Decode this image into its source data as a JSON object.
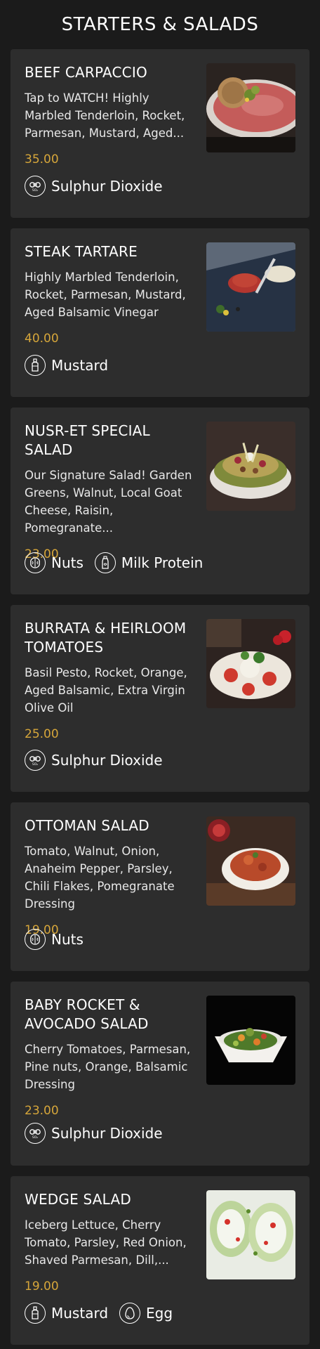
{
  "section": {
    "title": "STARTERS & SALADS"
  },
  "accent_color": "#d6a63a",
  "items": [
    {
      "title": "BEEF CARPACCIO",
      "description": "Tap to WATCH! Highly Marbled Tenderloin, Rocket, Parmesan, Mustard, Aged...",
      "price": "35.00",
      "allergens": [
        {
          "label": "Sulphur Dioxide",
          "icon": "sulphur-dioxide-icon"
        }
      ]
    },
    {
      "title": "STEAK TARTARE",
      "description": "Highly Marbled Tenderloin, Rocket, Parmesan, Mustard, Aged Balsamic Vinegar",
      "price": "40.00",
      "allergens": [
        {
          "label": "Mustard",
          "icon": "mustard-icon"
        }
      ]
    },
    {
      "title": "NUSR-ET SPECIAL SALAD",
      "description": "Our Signature Salad! Garden Greens, Walnut, Local Goat Cheese, Raisin, Pomegranate...",
      "price": "23.00",
      "allergens": [
        {
          "label": "Nuts",
          "icon": "nuts-icon"
        },
        {
          "label": "Milk Protein",
          "icon": "milk-icon"
        }
      ]
    },
    {
      "title": "BURRATA & HEIRLOOM TOMATOES",
      "description": "Basil Pesto, Rocket, Orange, Aged Balsamic, Extra Virgin Olive Oil",
      "price": "25.00",
      "allergens": [
        {
          "label": "Sulphur Dioxide",
          "icon": "sulphur-dioxide-icon"
        }
      ]
    },
    {
      "title": "OTTOMAN SALAD",
      "description": "Tomato, Walnut, Onion, Anaheim Pepper, Parsley, Chili Flakes, Pomegranate Dressing",
      "price": "19.00",
      "allergens": [
        {
          "label": "Nuts",
          "icon": "nuts-icon"
        }
      ]
    },
    {
      "title": "BABY ROCKET & AVOCADO SALAD",
      "description": "Cherry Tomatoes, Parmesan, Pine nuts, Orange, Balsamic Dressing",
      "price": "23.00",
      "allergens": [
        {
          "label": "Sulphur Dioxide",
          "icon": "sulphur-dioxide-icon"
        }
      ]
    },
    {
      "title": "WEDGE SALAD",
      "description": "Iceberg Lettuce, Cherry Tomato, Parsley, Red Onion, Shaved Parmesan, Dill,...",
      "price": "19.00",
      "allergens": [
        {
          "label": "Mustard",
          "icon": "mustard-icon"
        },
        {
          "label": "Egg",
          "icon": "egg-icon"
        }
      ]
    }
  ]
}
